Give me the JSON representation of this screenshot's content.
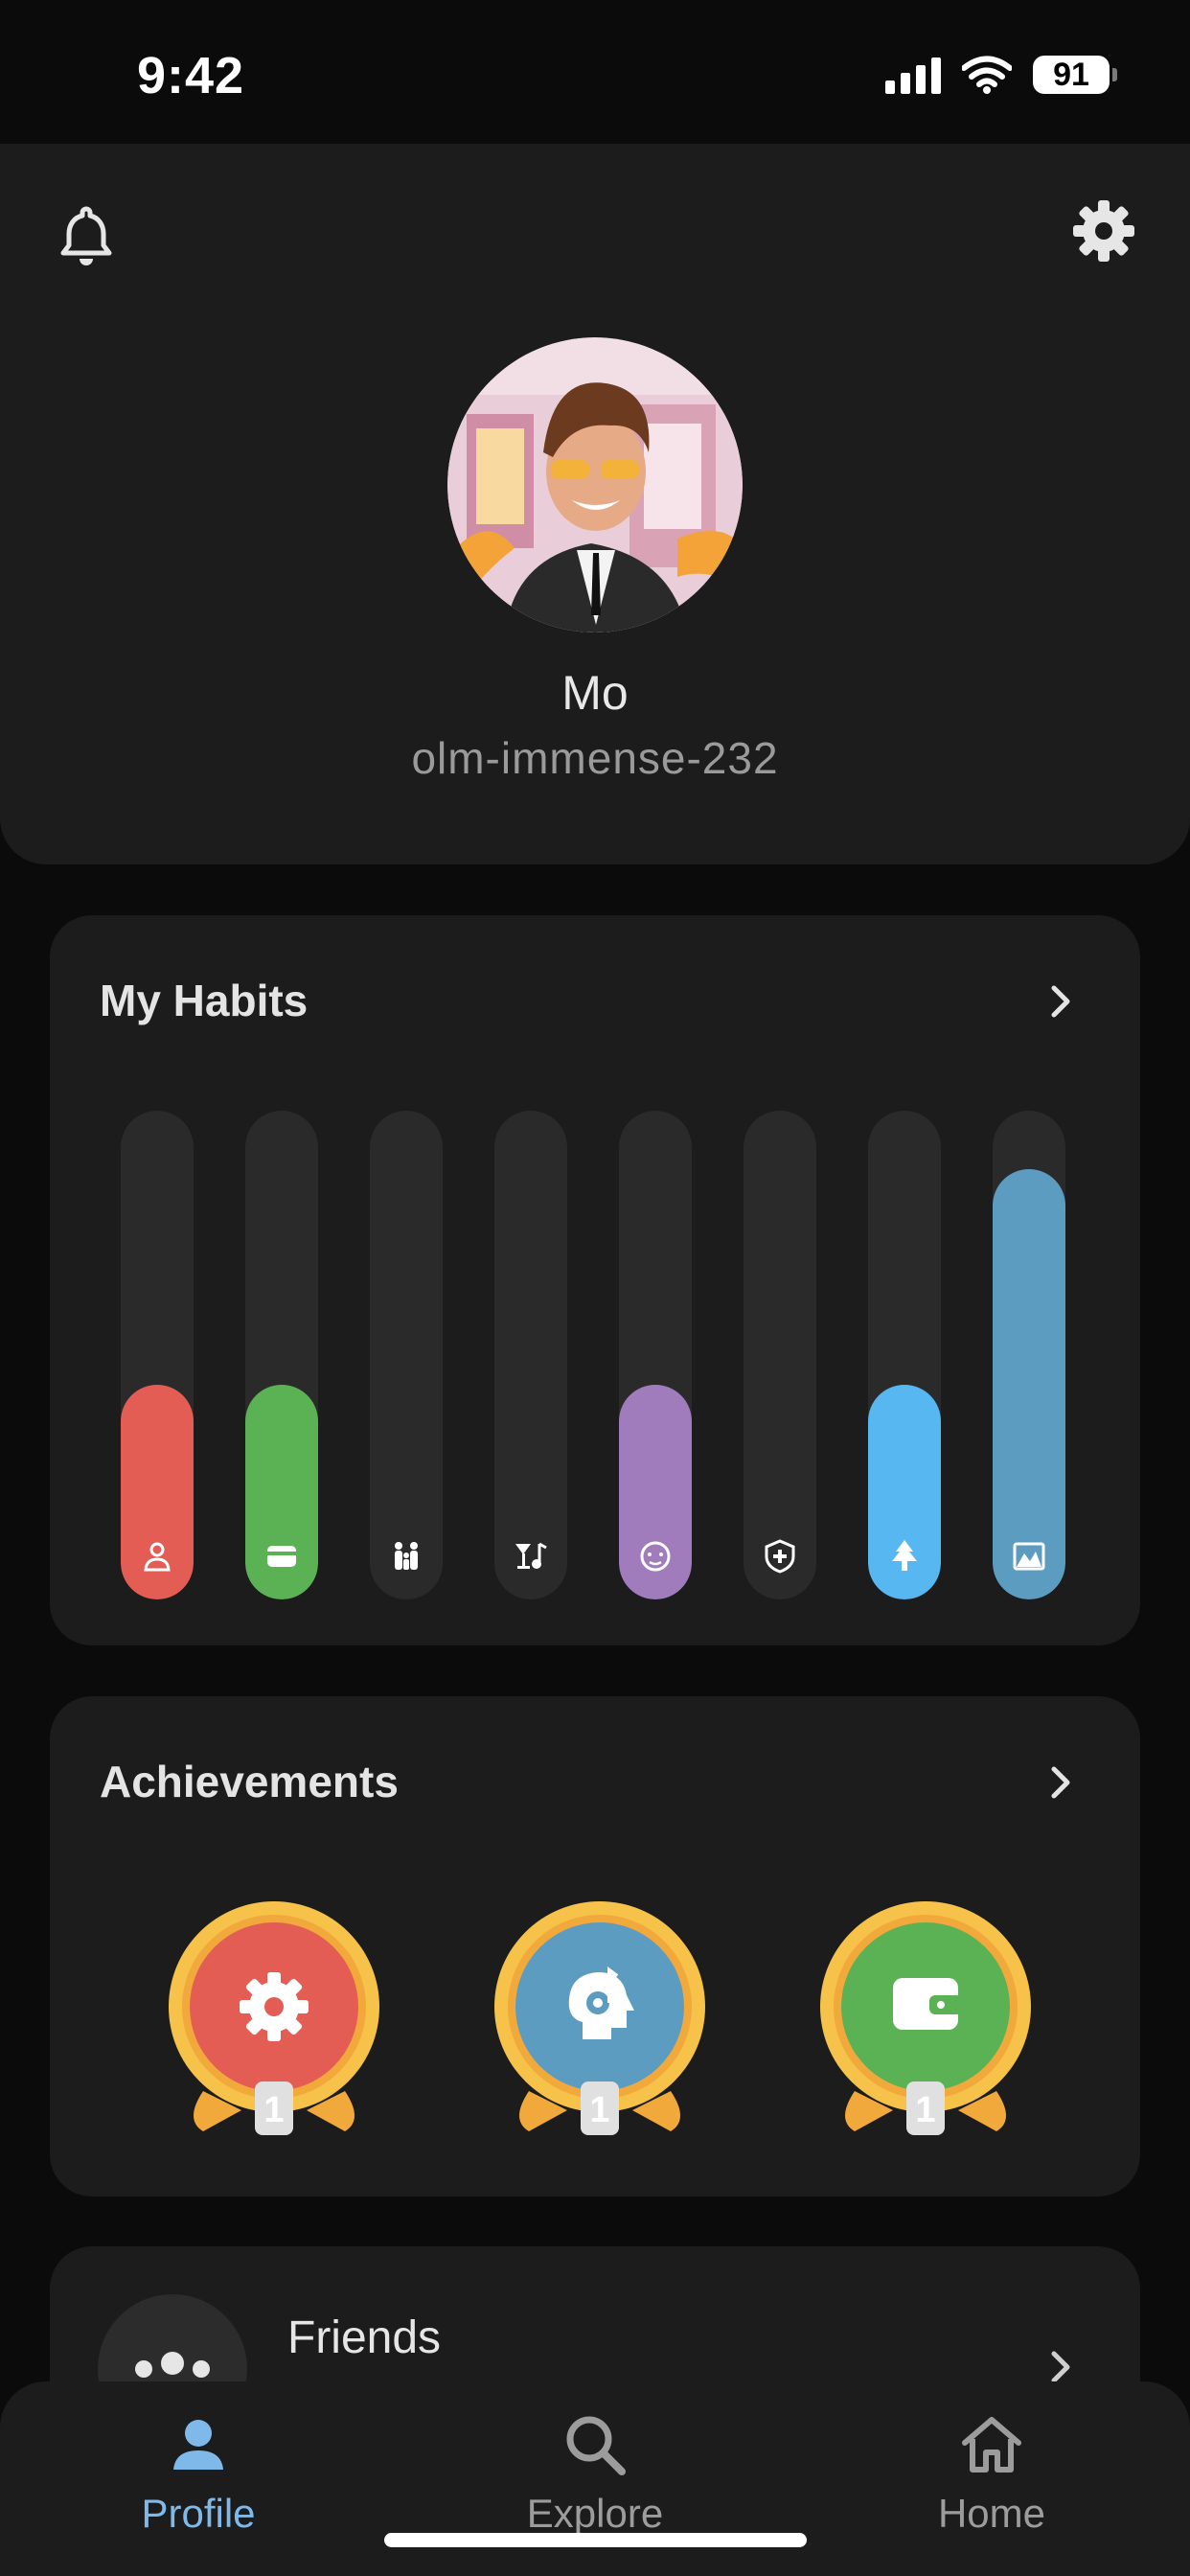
{
  "status_bar": {
    "time": "9:42",
    "battery": "91"
  },
  "profile": {
    "name": "Mo",
    "username": "olm-immense-232"
  },
  "habits": {
    "title": "My Habits",
    "bars": [
      {
        "icon": "person-icon",
        "level": 0.44,
        "color": "#e45d55"
      },
      {
        "icon": "wallet-icon",
        "level": 0.44,
        "color": "#5bb254"
      },
      {
        "icon": "family-icon",
        "level": 0.0,
        "color": "#2a2a2a"
      },
      {
        "icon": "cocktail-music-icon",
        "level": 0.0,
        "color": "#2a2a2a"
      },
      {
        "icon": "brain-icon",
        "level": 0.44,
        "color": "#a07cbd"
      },
      {
        "icon": "health-shield-icon",
        "level": 0.0,
        "color": "#2a2a2a"
      },
      {
        "icon": "tree-icon",
        "level": 0.44,
        "color": "#56b7f1"
      },
      {
        "icon": "landscape-icon",
        "level": 0.88,
        "color": "#5d9cc1"
      }
    ]
  },
  "achievements": {
    "title": "Achievements",
    "items": [
      {
        "icon": "gear-icon",
        "color": "#e45d55",
        "level": "1"
      },
      {
        "icon": "head-music-icon",
        "color": "#5d9cc1",
        "level": "1"
      },
      {
        "icon": "wallet-icon",
        "color": "#5bb254",
        "level": "1"
      }
    ]
  },
  "friends": {
    "label": "Friends"
  },
  "tabs": [
    {
      "label": "Profile",
      "icon": "person-icon",
      "active": true
    },
    {
      "label": "Explore",
      "icon": "search-icon",
      "active": false
    },
    {
      "label": "Home",
      "icon": "home-icon",
      "active": false
    }
  ]
}
